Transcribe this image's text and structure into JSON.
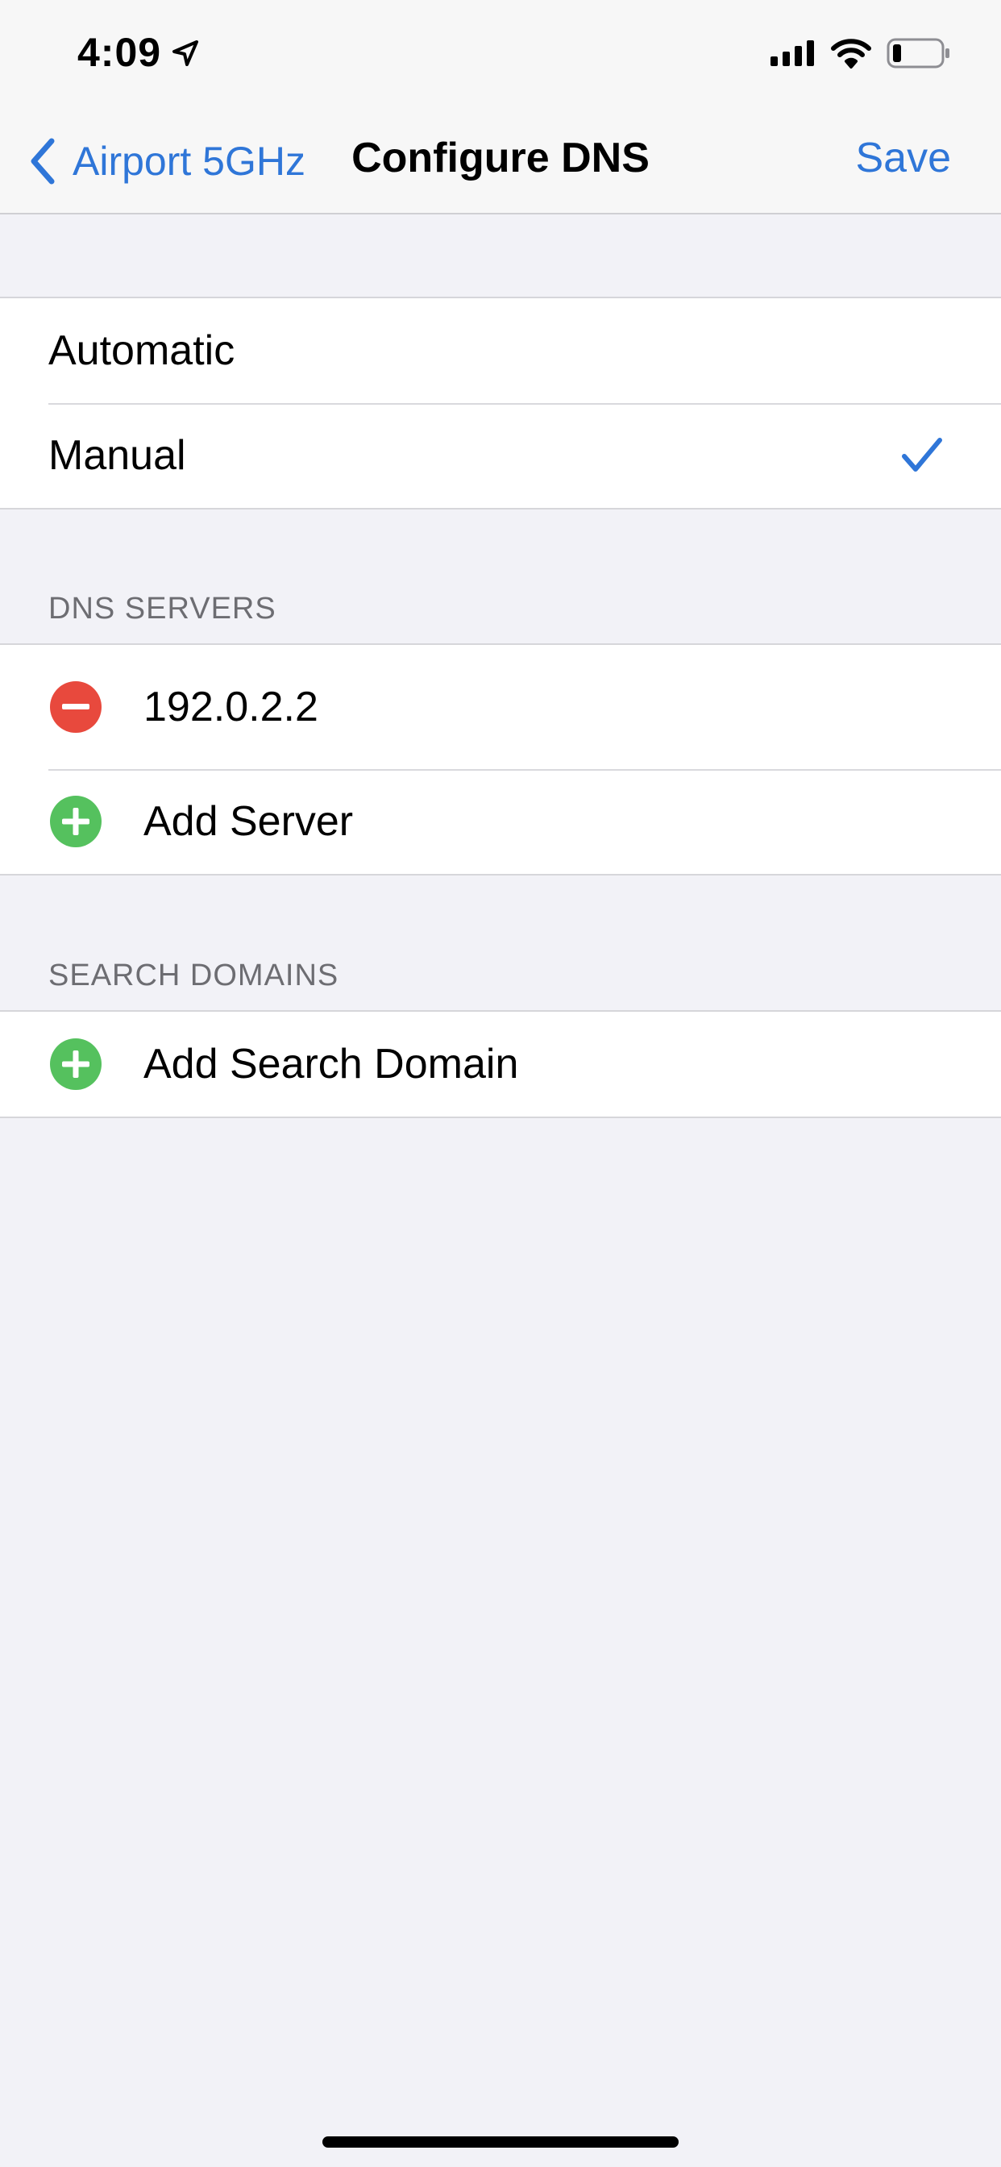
{
  "status_bar": {
    "time": "4:09"
  },
  "nav": {
    "back_label": "Airport 5GHz",
    "title": "Configure DNS",
    "save_label": "Save"
  },
  "mode_options": {
    "automatic": "Automatic",
    "manual": "Manual",
    "selected": "Manual"
  },
  "dns_servers": {
    "header": "DNS SERVERS",
    "servers": [
      "192.0.2.2"
    ],
    "add_label": "Add Server"
  },
  "search_domains": {
    "header": "SEARCH DOMAINS",
    "add_label": "Add Search Domain"
  },
  "colors": {
    "accent": "#2f76d8",
    "delete": "#e8493d",
    "add": "#55c15e",
    "background": "#f2f2f7"
  }
}
